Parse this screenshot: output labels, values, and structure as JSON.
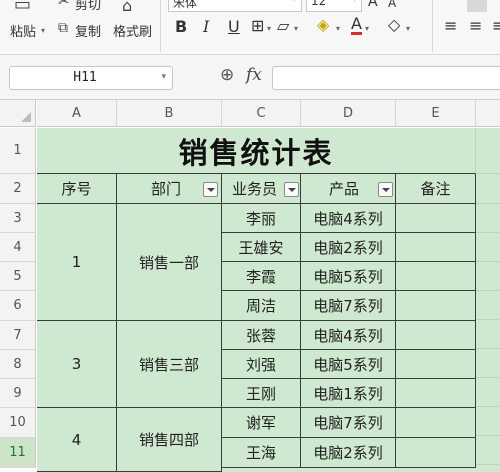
{
  "ribbon": {
    "cut_label": "剪切",
    "paste_label": "粘贴",
    "copy_label": "复制",
    "format_painter_label": "格式刷",
    "font_name": "宋体",
    "font_size": "12",
    "increase_font": "A",
    "decrease_font": "A",
    "bold": "B",
    "italic": "I",
    "underline": "U",
    "font_color_letter": "A"
  },
  "formula_bar": {
    "cell_ref": "H11",
    "zoom_icon": "zoom-icon",
    "fx": "fx",
    "formula_value": ""
  },
  "columns": [
    "A",
    "B",
    "C",
    "D",
    "E"
  ],
  "rows": [
    "1",
    "2",
    "3",
    "4",
    "5",
    "6",
    "7",
    "8",
    "9",
    "10",
    "11"
  ],
  "selected_row": "11",
  "sheet": {
    "title": "销售统计表",
    "headers": {
      "seq": "序号",
      "dept": "部门",
      "staff": "业务员",
      "product": "产品",
      "note": "备注"
    },
    "groups": [
      {
        "seq": "1",
        "dept": "销售一部",
        "entries": [
          {
            "staff": "李丽",
            "product": "电脑4系列"
          },
          {
            "staff": "王雄安",
            "product": "电脑2系列"
          },
          {
            "staff": "李霞",
            "product": "电脑5系列"
          },
          {
            "staff": "周洁",
            "product": "电脑7系列"
          }
        ]
      },
      {
        "seq": "3",
        "dept": "销售三部",
        "entries": [
          {
            "staff": "张蓉",
            "product": "电脑4系列"
          },
          {
            "staff": "刘强",
            "product": "电脑5系列"
          },
          {
            "staff": "王刚",
            "product": "电脑1系列"
          }
        ]
      },
      {
        "seq": "4",
        "dept": "销售四部",
        "entries": [
          {
            "staff": "谢军",
            "product": "电脑7系列"
          },
          {
            "staff": "王海",
            "product": "电脑2系列"
          }
        ]
      }
    ]
  },
  "colors": {
    "sheet_fill": "#cfe8d0",
    "selection": "#1e7145",
    "grid_line": "#3b3b3b"
  }
}
